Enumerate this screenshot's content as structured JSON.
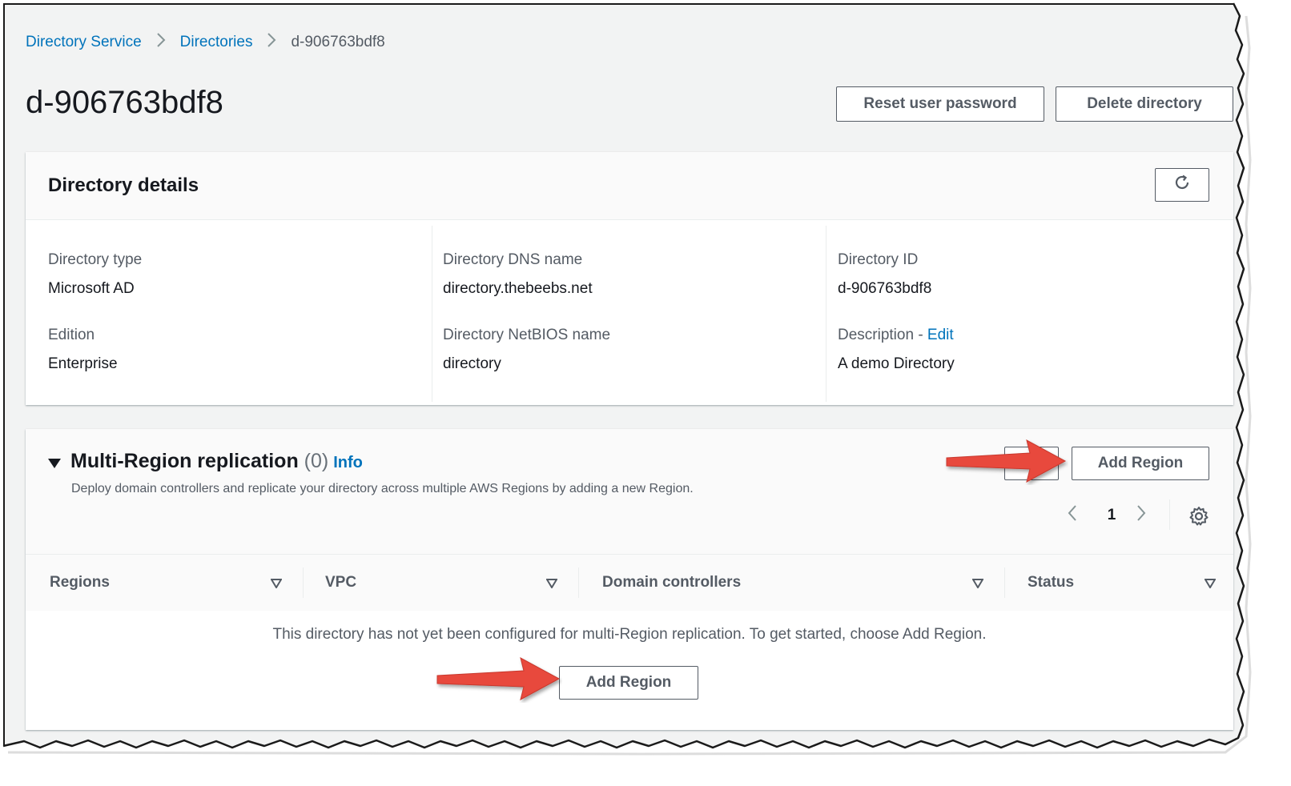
{
  "breadcrumb": {
    "items": [
      "Directory Service",
      "Directories"
    ],
    "current": "d-906763bdf8"
  },
  "header": {
    "title": "d-906763bdf8",
    "reset_password_label": "Reset user password",
    "delete_directory_label": "Delete directory"
  },
  "details": {
    "title": "Directory details",
    "refresh_icon": "refresh-icon",
    "fields": {
      "directory_type_label": "Directory type",
      "directory_type_value": "Microsoft AD",
      "edition_label": "Edition",
      "edition_value": "Enterprise",
      "dns_name_label": "Directory DNS name",
      "dns_name_value": "directory.thebeebs.net",
      "netbios_label": "Directory NetBIOS name",
      "netbios_value": "directory",
      "directory_id_label": "Directory ID",
      "directory_id_value": "d-906763bdf8",
      "description_label": "Description - ",
      "description_edit": "Edit",
      "description_value": "A demo Directory"
    }
  },
  "replication": {
    "title": "Multi-Region replication",
    "count": "(0)",
    "info_label": "Info",
    "description": "Deploy domain controllers and replicate your directory across multiple AWS Regions by adding a new Region.",
    "add_region_label": "Add Region",
    "page_number": "1",
    "columns": [
      "Regions",
      "VPC",
      "Domain controllers",
      "Status"
    ],
    "empty_message": "This directory has not yet been configured for multi-Region replication. To get started, choose Add Region.",
    "empty_add_region_label": "Add Region"
  },
  "colors": {
    "link": "#0073bb",
    "arrow": "#e8493c",
    "background": "#f2f3f3"
  }
}
